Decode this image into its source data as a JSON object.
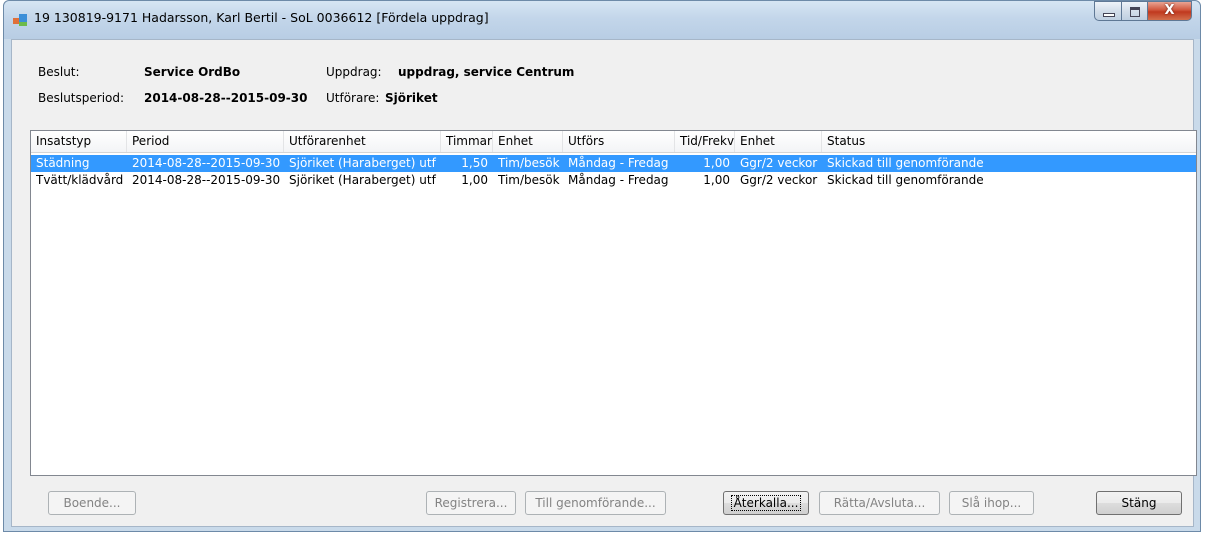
{
  "window": {
    "title": "19 130819-9171  Hadarsson, Karl Bertil  -  SoL  0036612  [Fördela uppdrag]",
    "close_glyph": "X"
  },
  "info": {
    "beslut_label": "Beslut:",
    "beslut_value": "Service OrdBo",
    "uppdrag_label": "Uppdrag:",
    "uppdrag_value": "uppdrag, service Centrum",
    "beslutsperiod_label": "Beslutsperiod:",
    "beslutsperiod_value": "2014-08-28--2015-09-30",
    "utforare_label": "Utförare:",
    "utforare_value": "Sjöriket"
  },
  "table": {
    "columns": [
      "Insatstyp",
      "Period",
      "Utförarenhet",
      "Timmar",
      "Enhet",
      "Utförs",
      "Tid/Frekv",
      "Enhet",
      "Status"
    ],
    "rows": [
      [
        "Städning",
        "2014-08-28--2015-09-30",
        "Sjöriket (Haraberget) utf",
        "1,50",
        "Tim/besök",
        "Måndag - Fredag",
        "1,00",
        "Ggr/2 veckor",
        "Skickad till genomförande"
      ],
      [
        "Tvätt/klädvård",
        "2014-08-28--2015-09-30",
        "Sjöriket (Haraberget) utf",
        "1,00",
        "Tim/besök",
        "Måndag - Fredag",
        "1,00",
        "Ggr/2 veckor",
        "Skickad till genomförande"
      ]
    ],
    "selected_row": 0
  },
  "buttons": {
    "boende": "Boende...",
    "registrera": "Registrera...",
    "till_genomforande": "Till genomförande...",
    "aterkalla": "Återkalla...",
    "ratta_avsluta": "Rätta/Avsluta...",
    "sla_ihop": "Slå ihop...",
    "stang": "Stäng"
  },
  "colors": {
    "selection": "#3399ff",
    "title_bar": "#c3d6ea",
    "close_button": "#c0391f"
  },
  "icons": [
    "app-icon",
    "minimize-icon",
    "maximize-icon",
    "close-icon"
  ]
}
